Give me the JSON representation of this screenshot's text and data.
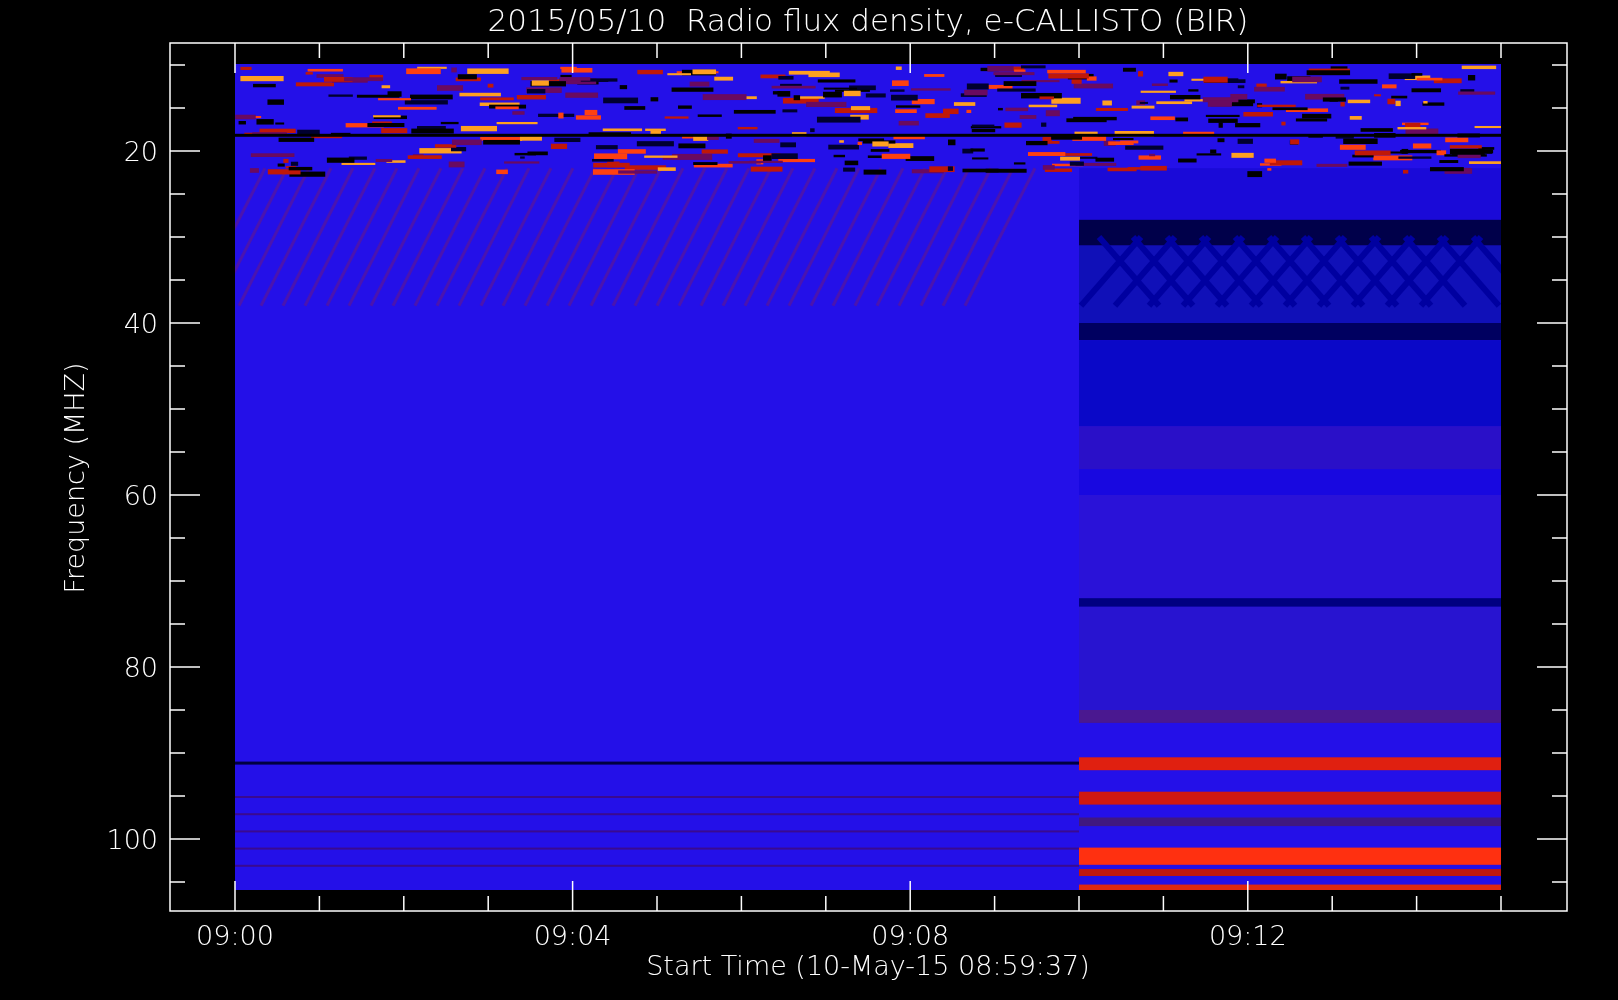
{
  "title": "2015/05/10  Radio flux density, e-CALLISTO (BIR)",
  "y_axis": {
    "label": "Frequency (MHZ)",
    "tick_labels": [
      "20",
      "40",
      "60",
      "80",
      "100"
    ]
  },
  "x_axis": {
    "label": "Start Time (10-May-15 08:59:37)",
    "tick_labels": [
      "09:00",
      "09:04",
      "09:08",
      "09:12"
    ]
  }
}
